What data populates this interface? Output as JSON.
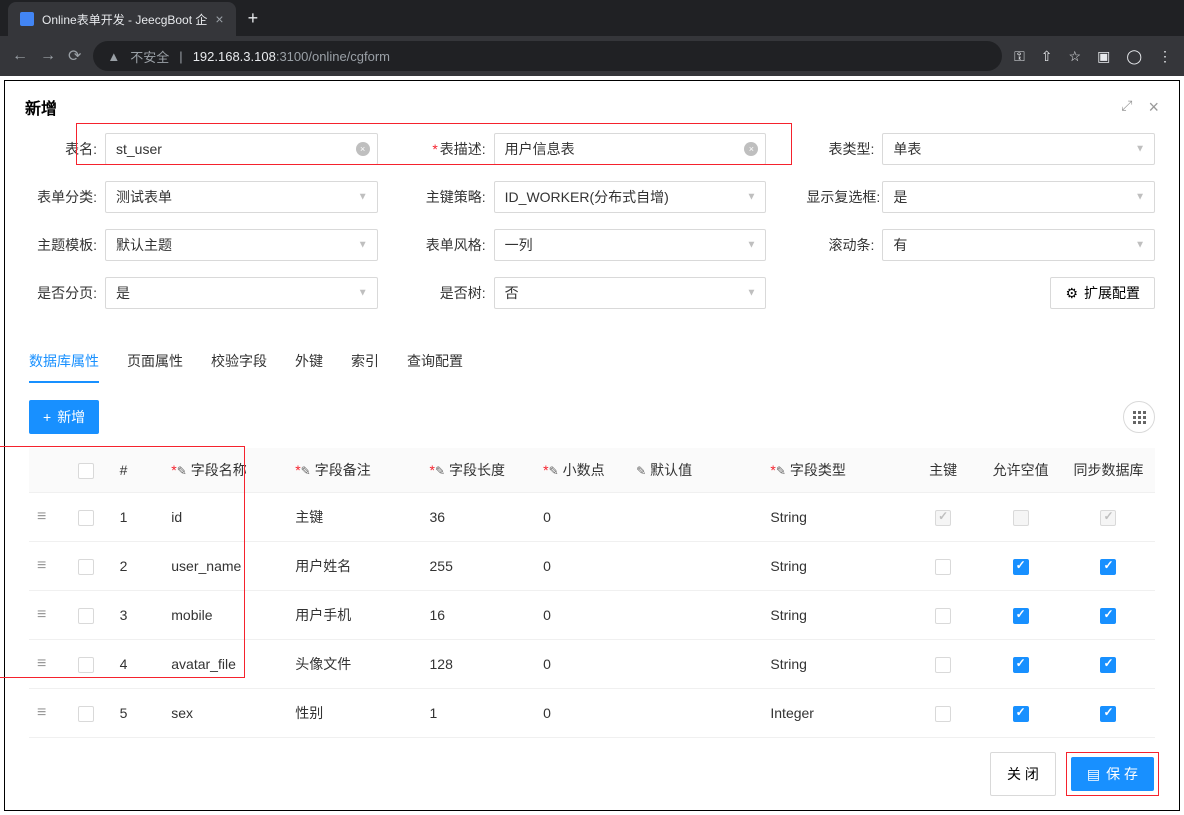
{
  "browser": {
    "tab_title": "Online表单开发 - JeecgBoot 企",
    "url_prefix": "不安全",
    "url_host": "192.168.3.108",
    "url_path": ":3100/online/cgform"
  },
  "modal": {
    "title": "新增"
  },
  "form": {
    "table_name": {
      "label": "表名:",
      "value": "st_user"
    },
    "table_desc": {
      "label": "表描述:",
      "value": "用户信息表"
    },
    "table_type": {
      "label": "表类型:",
      "value": "单表"
    },
    "form_category": {
      "label": "表单分类:",
      "value": "测试表单"
    },
    "pk_strategy": {
      "label": "主键策略:",
      "value": "ID_WORKER(分布式自增)"
    },
    "show_checkbox": {
      "label": "显示复选框:",
      "value": "是"
    },
    "theme_template": {
      "label": "主题模板:",
      "value": "默认主题"
    },
    "form_style": {
      "label": "表单风格:",
      "value": "一列"
    },
    "scrollbar": {
      "label": "滚动条:",
      "value": "有"
    },
    "pagination": {
      "label": "是否分页:",
      "value": "是"
    },
    "is_tree": {
      "label": "是否树:",
      "value": "否"
    },
    "ext_config": "扩展配置"
  },
  "tabs": [
    "数据库属性",
    "页面属性",
    "校验字段",
    "外键",
    "索引",
    "查询配置"
  ],
  "table": {
    "add_btn": "新增",
    "headers": {
      "index": "#",
      "field_name": "字段名称",
      "field_remark": "字段备注",
      "field_length": "字段长度",
      "decimal": "小数点",
      "default_val": "默认值",
      "field_type": "字段类型",
      "pk": "主键",
      "allow_null": "允许空值",
      "sync_db": "同步数据库"
    },
    "rows": [
      {
        "idx": "1",
        "name": "id",
        "remark": "主键",
        "length": "36",
        "decimal": "0",
        "default": "",
        "type": "String",
        "pk": true,
        "pk_disabled": true,
        "null": false,
        "null_disabled": true,
        "sync": true,
        "sync_disabled": true
      },
      {
        "idx": "2",
        "name": "user_name",
        "remark": "用户姓名",
        "length": "255",
        "decimal": "0",
        "default": "",
        "type": "String",
        "pk": false,
        "pk_disabled": false,
        "null": true,
        "null_disabled": false,
        "sync": true,
        "sync_disabled": false
      },
      {
        "idx": "3",
        "name": "mobile",
        "remark": "用户手机",
        "length": "16",
        "decimal": "0",
        "default": "",
        "type": "String",
        "pk": false,
        "pk_disabled": false,
        "null": true,
        "null_disabled": false,
        "sync": true,
        "sync_disabled": false
      },
      {
        "idx": "4",
        "name": "avatar_file",
        "remark": "头像文件",
        "length": "128",
        "decimal": "0",
        "default": "",
        "type": "String",
        "pk": false,
        "pk_disabled": false,
        "null": true,
        "null_disabled": false,
        "sync": true,
        "sync_disabled": false
      },
      {
        "idx": "5",
        "name": "sex",
        "remark": "性别",
        "length": "1",
        "decimal": "0",
        "default": "",
        "type": "Integer",
        "pk": false,
        "pk_disabled": false,
        "null": true,
        "null_disabled": false,
        "sync": true,
        "sync_disabled": false
      }
    ]
  },
  "footer": {
    "close": "关 闭",
    "save": "保 存"
  }
}
